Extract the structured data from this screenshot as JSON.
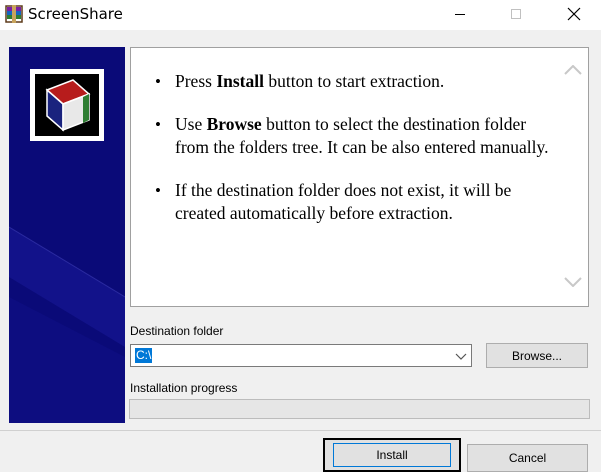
{
  "window": {
    "title": "ScreenShare",
    "controls": {
      "minimize_icon": "minimize-icon",
      "maximize_icon": "maximize-icon",
      "close_icon": "close-icon"
    }
  },
  "banner": {
    "background": "#0a0a78",
    "logo_icon": "archive-book-icon"
  },
  "info": {
    "items": [
      {
        "pre": "Press ",
        "bold": "Install",
        "post": " button to start extraction."
      },
      {
        "pre": "Use ",
        "bold": "Browse",
        "post": " button to select the destination folder from the folders tree. It can be also entered manually."
      },
      {
        "pre": "",
        "bold": "",
        "post": "If the destination folder does not exist, it will be created automatically before extraction."
      }
    ]
  },
  "destination": {
    "label": "Destination folder",
    "value": "C:\\",
    "browse_label": "Browse..."
  },
  "progress": {
    "label": "Installation progress",
    "value": 0
  },
  "buttons": {
    "install_label": "Install",
    "cancel_label": "Cancel"
  },
  "colors": {
    "selection": "#0078d7",
    "focus_border": "#000000"
  }
}
